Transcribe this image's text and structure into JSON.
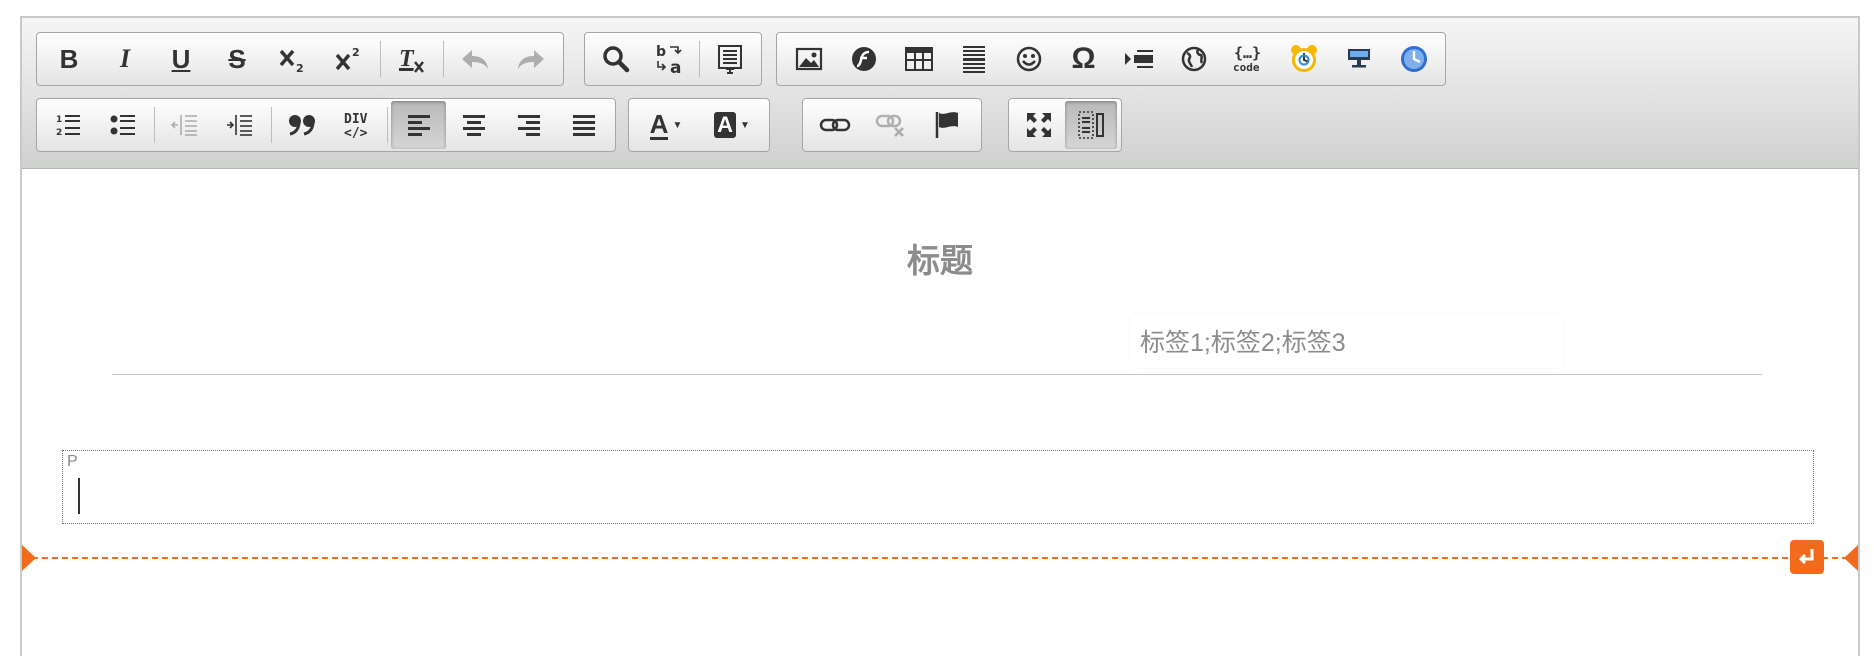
{
  "toolbar": {
    "row1": [
      {
        "group": "basicstyles",
        "buttons": [
          "bold",
          "italic",
          "underline",
          "strike",
          "subscript",
          "superscript",
          "removeformat",
          "undo",
          "redo"
        ]
      },
      {
        "group": "editing",
        "buttons": [
          "find",
          "replace",
          "templates"
        ]
      },
      {
        "group": "insert",
        "buttons": [
          "image",
          "flash",
          "table",
          "horizontal-rule",
          "smiley",
          "special-char",
          "page-break",
          "iframe",
          "code-snippet",
          "date",
          "notification",
          "clock"
        ]
      }
    ],
    "row2": [
      {
        "group": "paragraph",
        "buttons": [
          "numbered-list",
          "bulleted-list",
          "outdent",
          "indent",
          "blockquote",
          "creatediv",
          "align-left",
          "align-center",
          "align-right",
          "justify"
        ]
      },
      {
        "group": "colors",
        "buttons": [
          "text-color",
          "background-color"
        ]
      },
      {
        "group": "links",
        "buttons": [
          "link",
          "unlink",
          "anchor"
        ]
      },
      {
        "group": "tools",
        "buttons": [
          "maximize",
          "showblocks"
        ]
      }
    ],
    "labels": {
      "bold": "B",
      "italic": "I",
      "underline": "U",
      "strike": "S",
      "omega": "Ω",
      "div": "DIV",
      "code": "code",
      "text_color": "A",
      "bg_color": "A"
    }
  },
  "document": {
    "title": "标题",
    "tags": "标签1;标签2;标签3",
    "block_tag": "P"
  },
  "colors": {
    "accent": "#f26b1d",
    "title": "#8c8c8c",
    "active_button": "#bfbfbf"
  }
}
